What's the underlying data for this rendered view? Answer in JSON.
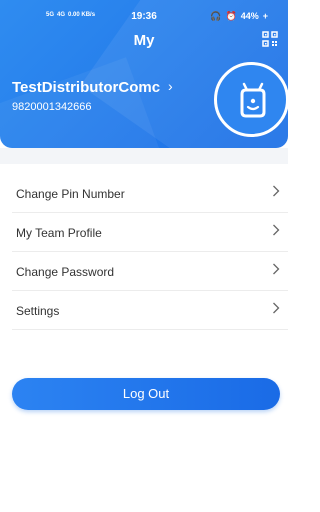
{
  "status_bar": {
    "network_left": "5G",
    "network_right": "4G",
    "speed": "0.00 KB/s",
    "time": "19:36",
    "battery": "44%"
  },
  "header": {
    "title": "My",
    "username": "TestDistributorComc",
    "phone": "9820001342666"
  },
  "menu": [
    {
      "label": "Change Pin Number"
    },
    {
      "label": "My Team Profile"
    },
    {
      "label": "Change Password"
    },
    {
      "label": "Settings"
    }
  ],
  "logout_label": "Log Out",
  "colors": {
    "primary": "#1c6fe6",
    "header_light": "#2f8cf0",
    "text": "#333333",
    "divider": "#ececec"
  }
}
